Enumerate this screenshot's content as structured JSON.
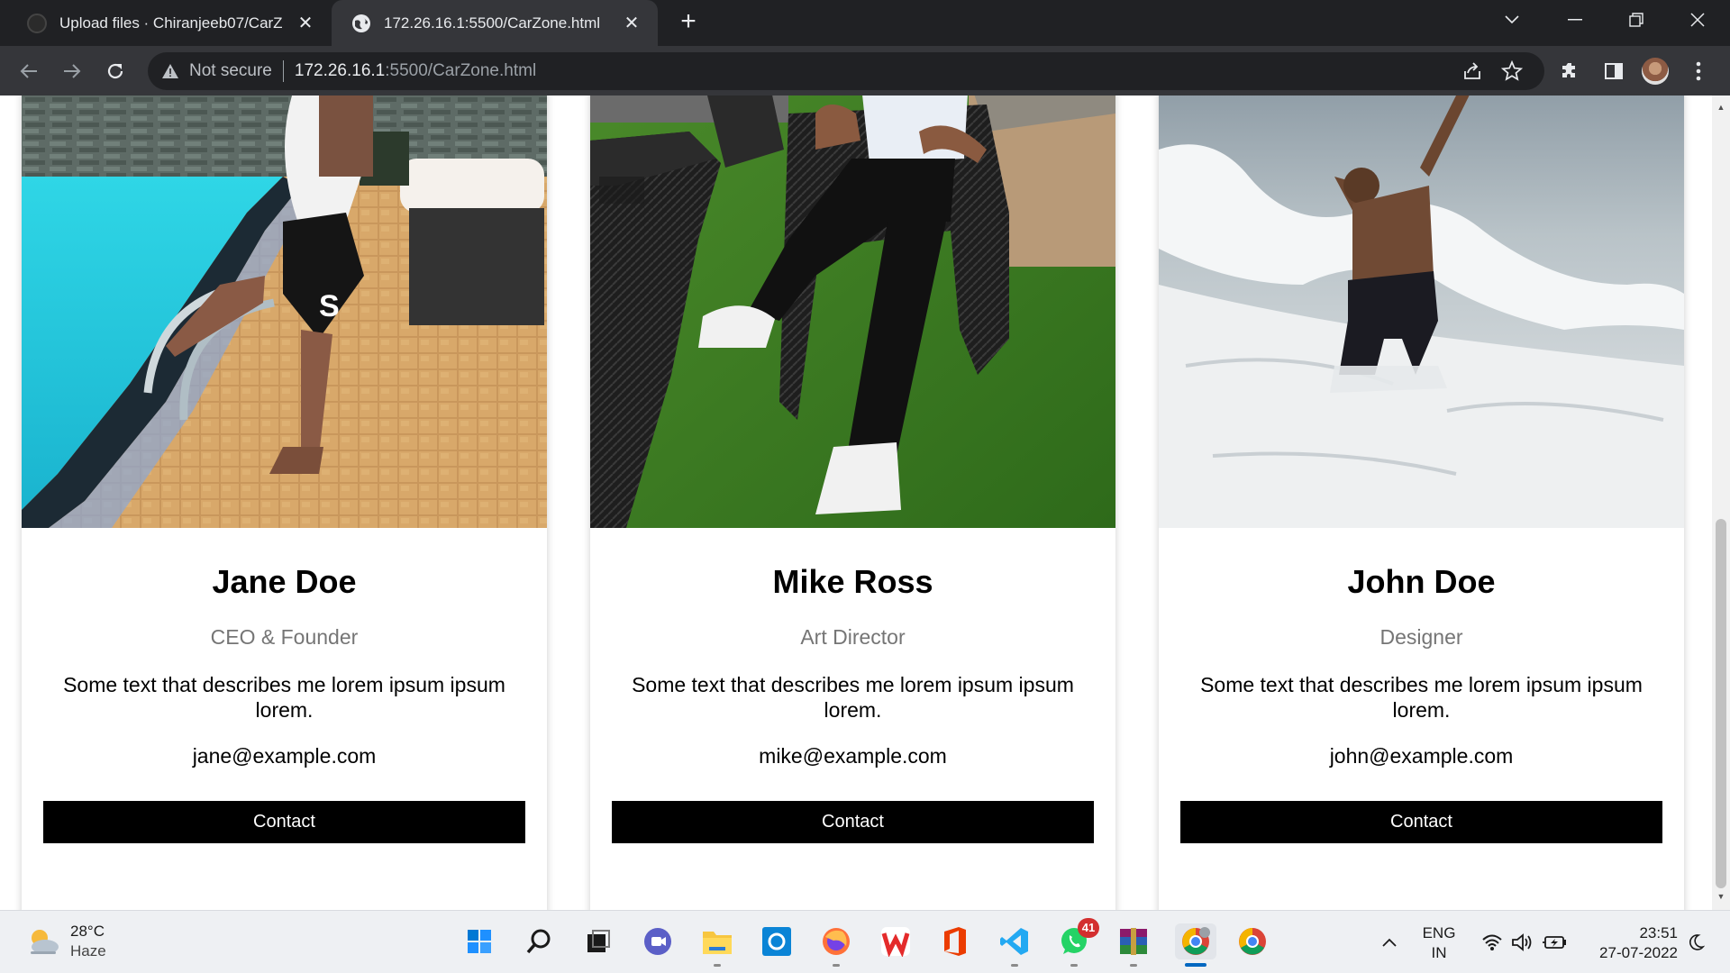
{
  "browser": {
    "tabs": [
      {
        "title": "Upload files · Chiranjeeb07/CarZ",
        "active": false
      },
      {
        "title": "172.26.16.1:5500/CarZone.html",
        "active": true
      }
    ],
    "address": {
      "security_label": "Not secure",
      "host": "172.26.16.1",
      "path": ":5500/CarZone.html"
    }
  },
  "team": [
    {
      "name": "Jane Doe",
      "role": "CEO & Founder",
      "description": "Some text that describes me lorem ipsum ipsum lorem.",
      "email": "jane@example.com",
      "button": "Contact"
    },
    {
      "name": "Mike Ross",
      "role": "Art Director",
      "description": "Some text that describes me lorem ipsum ipsum lorem.",
      "email": "mike@example.com",
      "button": "Contact"
    },
    {
      "name": "John Doe",
      "role": "Designer",
      "description": "Some text that describes me lorem ipsum ipsum lorem.",
      "email": "john@example.com",
      "button": "Contact"
    }
  ],
  "taskbar": {
    "weather": {
      "temp": "28°C",
      "condition": "Haze"
    },
    "apps": [
      "start-icon",
      "search-icon",
      "task-view-icon",
      "teams-chat-icon",
      "file-explorer-icon",
      "app-icon",
      "firefox-icon",
      "wps-office-icon",
      "office-icon",
      "vscode-icon",
      "whatsapp-icon",
      "winrar-icon",
      "chrome-dev-icon",
      "chrome-icon"
    ],
    "whatsapp_badge": "41",
    "language": {
      "line1": "ENG",
      "line2": "IN"
    },
    "clock": {
      "time": "23:51",
      "date": "27-07-2022"
    }
  },
  "colors": {
    "chrome_dark": "#202124",
    "chrome_toolbar": "#35363a",
    "button_bg": "#000000",
    "role_text": "#757575",
    "taskbar_bg": "#eef0f3"
  }
}
